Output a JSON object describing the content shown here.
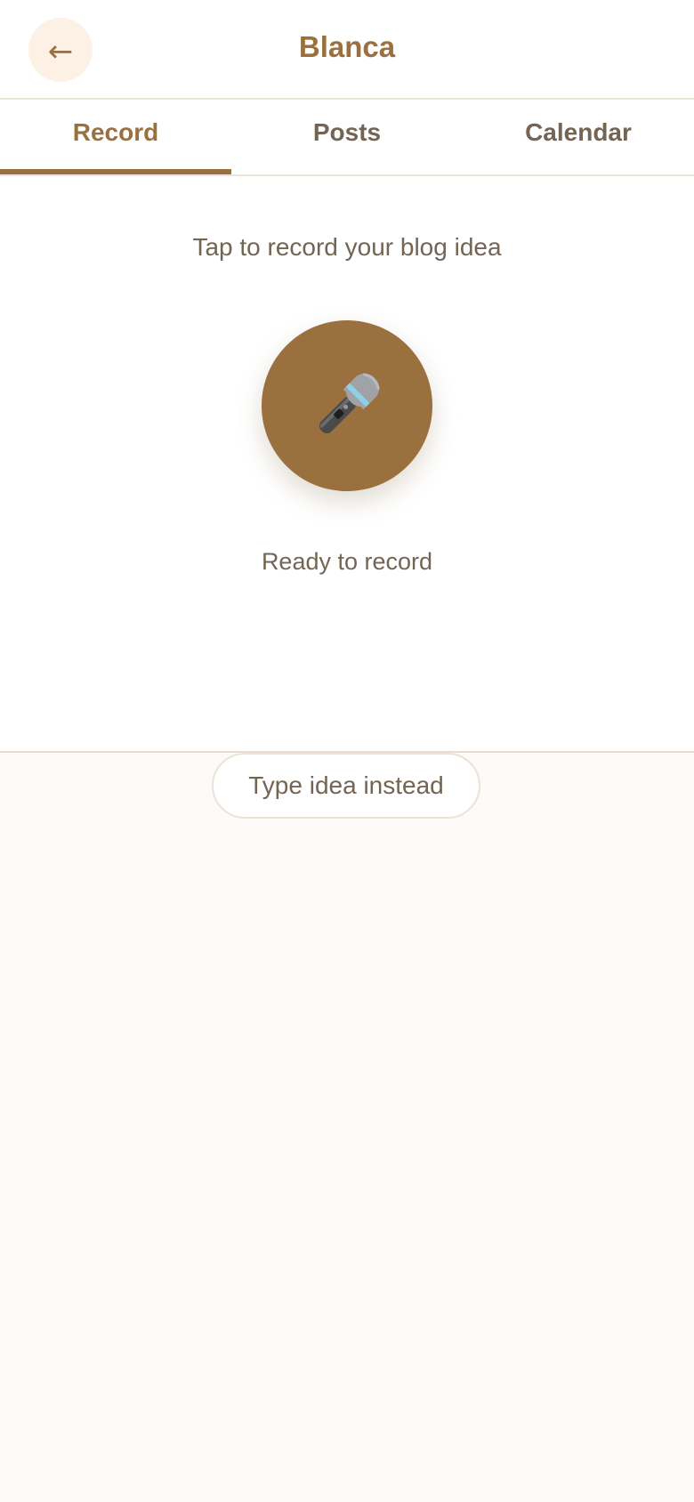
{
  "header": {
    "back_icon": "back-arrow-icon",
    "back_glyph": "←",
    "title": "Blanca"
  },
  "tabs": [
    {
      "label": "Record",
      "active": true
    },
    {
      "label": "Posts",
      "active": false
    },
    {
      "label": "Calendar",
      "active": false
    }
  ],
  "record": {
    "prompt": "Tap to record your blog idea",
    "mic_icon": "microphone-icon",
    "status": "Ready to record"
  },
  "footer": {
    "type_button_label": "Type idea instead"
  },
  "colors": {
    "accent": "#9b703f",
    "text_muted": "#736453",
    "back_button_bg": "#fdf1e6",
    "page_bg": "#fcfbf9"
  }
}
